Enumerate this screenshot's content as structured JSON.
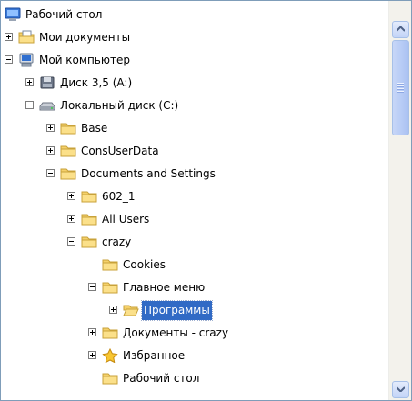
{
  "tree": {
    "items": [
      {
        "label": "Рабочий стол",
        "depth": 0,
        "expander": "none",
        "icon": "desktop-icon"
      },
      {
        "label": "Мои документы",
        "depth": 1,
        "expander": "plus",
        "icon": "my-documents-icon"
      },
      {
        "label": "Мой компьютер",
        "depth": 1,
        "expander": "minus",
        "icon": "my-computer-icon"
      },
      {
        "label": "Диск 3,5 (A:)",
        "depth": 2,
        "expander": "plus",
        "icon": "floppy-drive-icon"
      },
      {
        "label": "Локальный диск (C:)",
        "depth": 2,
        "expander": "minus",
        "icon": "hard-drive-icon"
      },
      {
        "label": "Base",
        "depth": 3,
        "expander": "plus",
        "icon": "folder-icon"
      },
      {
        "label": "ConsUserData",
        "depth": 3,
        "expander": "plus",
        "icon": "folder-icon"
      },
      {
        "label": "Documents and Settings",
        "depth": 3,
        "expander": "minus",
        "icon": "folder-icon"
      },
      {
        "label": "602_1",
        "depth": 4,
        "expander": "plus",
        "icon": "folder-icon"
      },
      {
        "label": "All Users",
        "depth": 4,
        "expander": "plus",
        "icon": "folder-icon"
      },
      {
        "label": "crazy",
        "depth": 4,
        "expander": "minus",
        "icon": "folder-icon"
      },
      {
        "label": "Cookies",
        "depth": 5,
        "expander": "none",
        "icon": "folder-icon"
      },
      {
        "label": "Главное меню",
        "depth": 5,
        "expander": "minus",
        "icon": "folder-icon"
      },
      {
        "label": "Программы",
        "depth": 6,
        "expander": "plus",
        "icon": "folder-open-icon",
        "selected": true
      },
      {
        "label": "Документы - crazy",
        "depth": 5,
        "expander": "plus",
        "icon": "folder-icon"
      },
      {
        "label": "Избранное",
        "depth": 5,
        "expander": "plus",
        "icon": "favorites-star-icon"
      },
      {
        "label": "Рабочий стол",
        "depth": 5,
        "expander": "none",
        "icon": "folder-icon"
      }
    ]
  },
  "colors": {
    "selection": "#316ac5",
    "folder": "#f5d06a",
    "scrollbar_thumb": "#b9cdf6"
  }
}
